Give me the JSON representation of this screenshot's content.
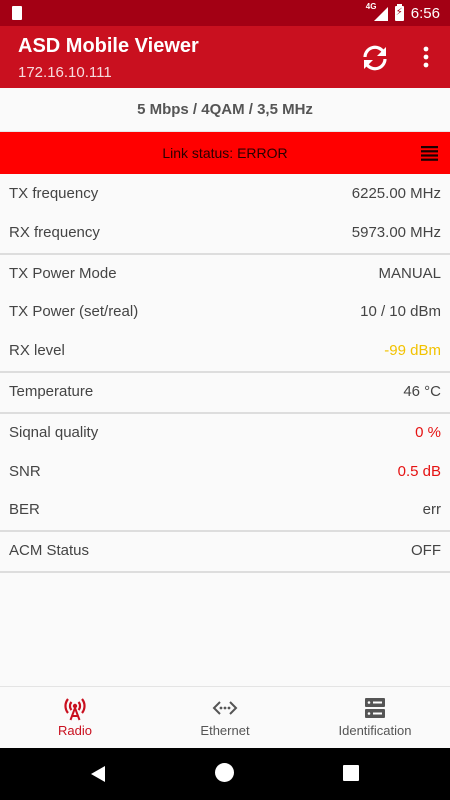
{
  "status_bar": {
    "network_type": "4G",
    "battery_icon": "battery-charging-icon",
    "time": "6:56"
  },
  "app_bar": {
    "title": "ASD Mobile Viewer",
    "subtitle": "172.16.10.111",
    "refresh_icon": "refresh-icon",
    "menu_icon": "more-vert-icon"
  },
  "mode": "5 Mbps / 4QAM / 3,5 MHz",
  "link_status": {
    "text": "Link status: ERROR",
    "icon": "list-icon",
    "background": "#ff0000"
  },
  "groups": [
    [
      {
        "label": "TX frequency",
        "value": "6225.00 MHz",
        "tone": "normal"
      },
      {
        "label": "RX frequency",
        "value": "5973.00 MHz",
        "tone": "normal"
      }
    ],
    [
      {
        "label": "TX Power Mode",
        "value": "MANUAL",
        "tone": "normal"
      },
      {
        "label": "TX Power (set/real)",
        "value": "10 / 10 dBm",
        "tone": "normal"
      },
      {
        "label": "RX level",
        "value": "-99 dBm",
        "tone": "warning"
      }
    ],
    [
      {
        "label": "Temperature",
        "value": "46 °C",
        "tone": "normal"
      }
    ],
    [
      {
        "label": "Siqnal quality",
        "value": "0 %",
        "tone": "error"
      },
      {
        "label": "SNR",
        "value": "0.5 dB",
        "tone": "error"
      },
      {
        "label": "BER",
        "value": "err",
        "tone": "normal"
      }
    ],
    [
      {
        "label": "ACM Status",
        "value": "OFF",
        "tone": "normal"
      }
    ]
  ],
  "bottom_nav": [
    {
      "label": "Radio",
      "icon": "radio-tower-icon",
      "active": true
    },
    {
      "label": "Ethernet",
      "icon": "ethernet-icon",
      "active": false
    },
    {
      "label": "Identification",
      "icon": "server-icon",
      "active": false
    }
  ],
  "colors": {
    "accent": "#c9101f",
    "status_bar": "#a30014",
    "warning": "#f2c200",
    "error": "#e51212"
  }
}
